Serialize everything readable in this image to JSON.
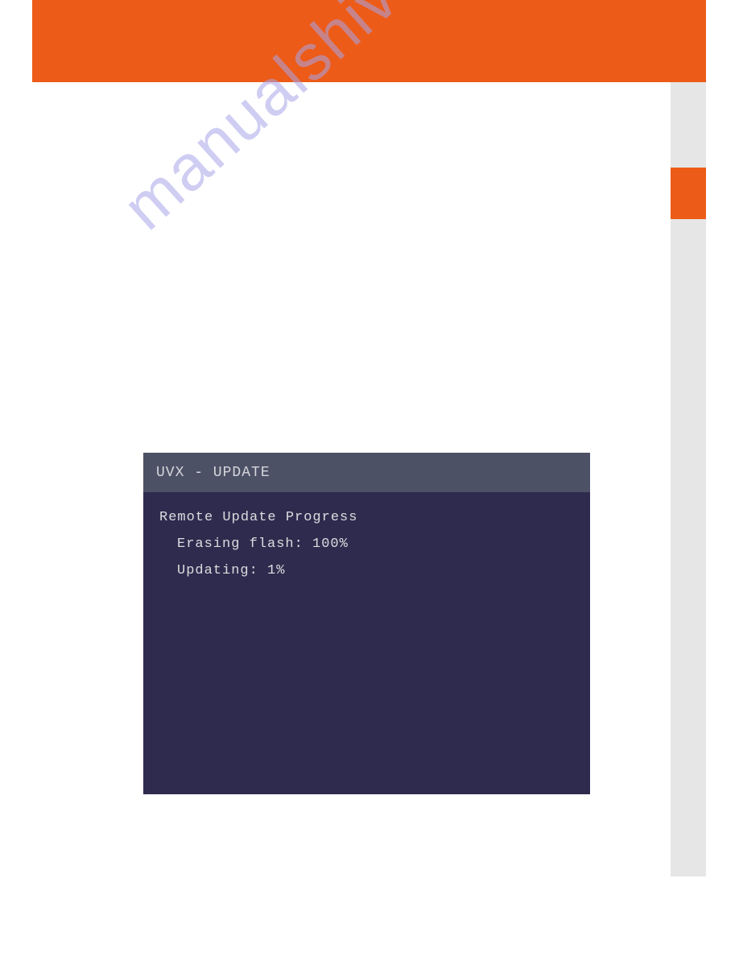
{
  "watermark": "manualshive.com",
  "panel": {
    "title": "UVX - UPDATE",
    "heading": "Remote Update Progress",
    "erase_label": "Erasing flash:",
    "erase_value": "100%",
    "update_label": "Updating:",
    "update_value": " 1%"
  }
}
